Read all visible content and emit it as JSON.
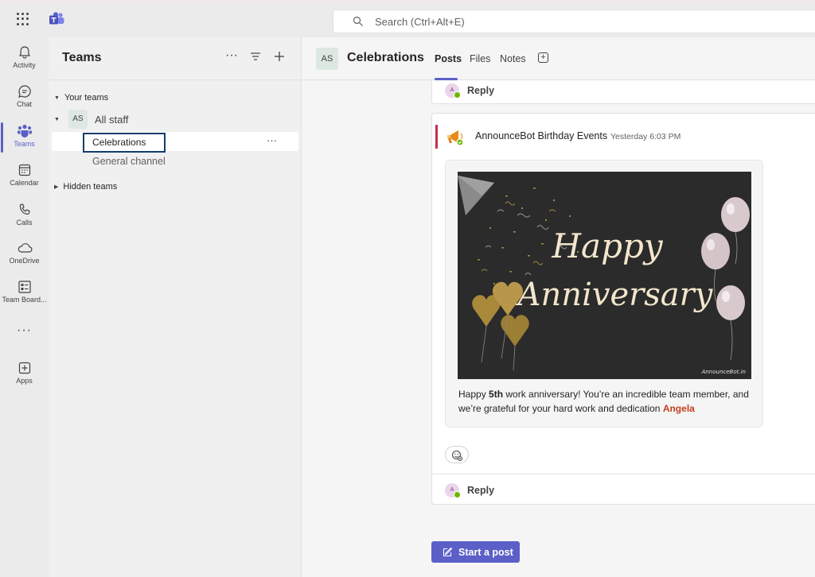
{
  "topbar": {
    "search_placeholder": "Search (Ctrl+Alt+E)"
  },
  "rail": {
    "items": [
      {
        "label": "Activity",
        "icon": "bell-icon"
      },
      {
        "label": "Chat",
        "icon": "chat-icon"
      },
      {
        "label": "Teams",
        "icon": "teams-icon"
      },
      {
        "label": "Calendar",
        "icon": "calendar-icon"
      },
      {
        "label": "Calls",
        "icon": "phone-icon"
      },
      {
        "label": "OneDrive",
        "icon": "cloud-icon"
      },
      {
        "label": "Team Board...",
        "icon": "board-icon"
      },
      {
        "label": "Apps",
        "icon": "add-app-icon"
      }
    ],
    "more": "···"
  },
  "teams_panel": {
    "title": "Teams",
    "your_teams": "Your teams",
    "team": {
      "avatar": "AS",
      "name": "All staff"
    },
    "channels": [
      "Celebrations",
      "General channel"
    ],
    "channel_more": "···",
    "hidden_teams": "Hidden teams"
  },
  "channel": {
    "avatar": "AS",
    "title": "Celebrations",
    "tabs": [
      "Posts",
      "Files",
      "Notes"
    ],
    "active_tab": "Posts"
  },
  "posts": {
    "reply_avatar": "A",
    "reply_label": "Reply",
    "bot_name": "AnnounceBot Birthday Events",
    "timestamp": "Yesterday 6:03 PM",
    "image": {
      "line1": "Happy",
      "line2": "Anniversary",
      "watermark": "AnnounceBot.in"
    },
    "message": {
      "prefix": "Happy ",
      "ordinal": "5th",
      "middle": " work anniversary! You’re an incredible team member, and we’re grateful for your hard work and dedication ",
      "mention": "Angela"
    }
  },
  "compose": {
    "start_post_label": "Start a post"
  },
  "colors": {
    "brand": "#5b5fc7",
    "mention": "#c43e1c",
    "accent_bar": "#c4314b",
    "selection_outline": "#0f3e6e"
  }
}
